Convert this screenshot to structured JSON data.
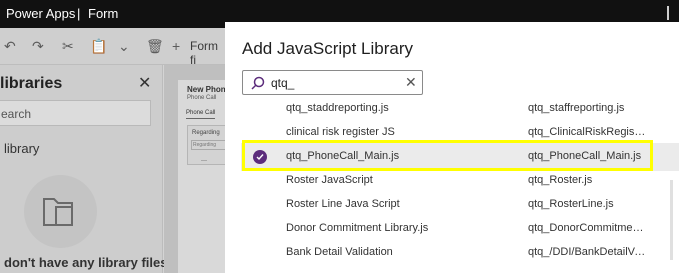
{
  "appbar": {
    "app_name": "Power Apps",
    "separator": "|",
    "page": "Form"
  },
  "toolbar": {
    "undo_icon": "undo-icon",
    "redo_icon": "redo-icon",
    "cut_icon": "cut-icon",
    "paste_icon": "paste-icon",
    "delete_icon": "delete-icon",
    "new_label": "Form fi"
  },
  "library_pane": {
    "title": "libraries",
    "search_placeholder": "earch",
    "add_label": "library",
    "empty_message": "don't have any library files"
  },
  "form_preview": {
    "title": "New Phone",
    "subtitle": "Phone Call",
    "tab": "Phone Call",
    "field_label": "Regarding",
    "field_value": "Regarding",
    "dash": "---"
  },
  "dialog": {
    "title": "Add JavaScript Library",
    "search_value": "qtq_",
    "rows": [
      {
        "display": "qtq_staddreporting.js",
        "name": "qtq_staffreporting.js",
        "selected": false
      },
      {
        "display": "clinical risk register JS",
        "name": "qtq_ClinicalRiskRegisterJS",
        "selected": false
      },
      {
        "display": "qtq_PhoneCall_Main.js",
        "name": "qtq_PhoneCall_Main.js",
        "selected": true
      },
      {
        "display": "Roster JavaScript",
        "name": "qtq_Roster.js",
        "selected": false
      },
      {
        "display": "Roster Line Java Script",
        "name": "qtq_RosterLine.js",
        "selected": false
      },
      {
        "display": "Donor Commitment Library.js",
        "name": "qtq_DonorCommitmentLi...",
        "selected": false
      },
      {
        "display": "Bank Detail Validation",
        "name": "qtq_/DDI/BankDetailValid...",
        "selected": false
      }
    ]
  },
  "colors": {
    "accent": "#5c2d7c",
    "highlight": "#ffff00",
    "appbar": "#111111"
  }
}
